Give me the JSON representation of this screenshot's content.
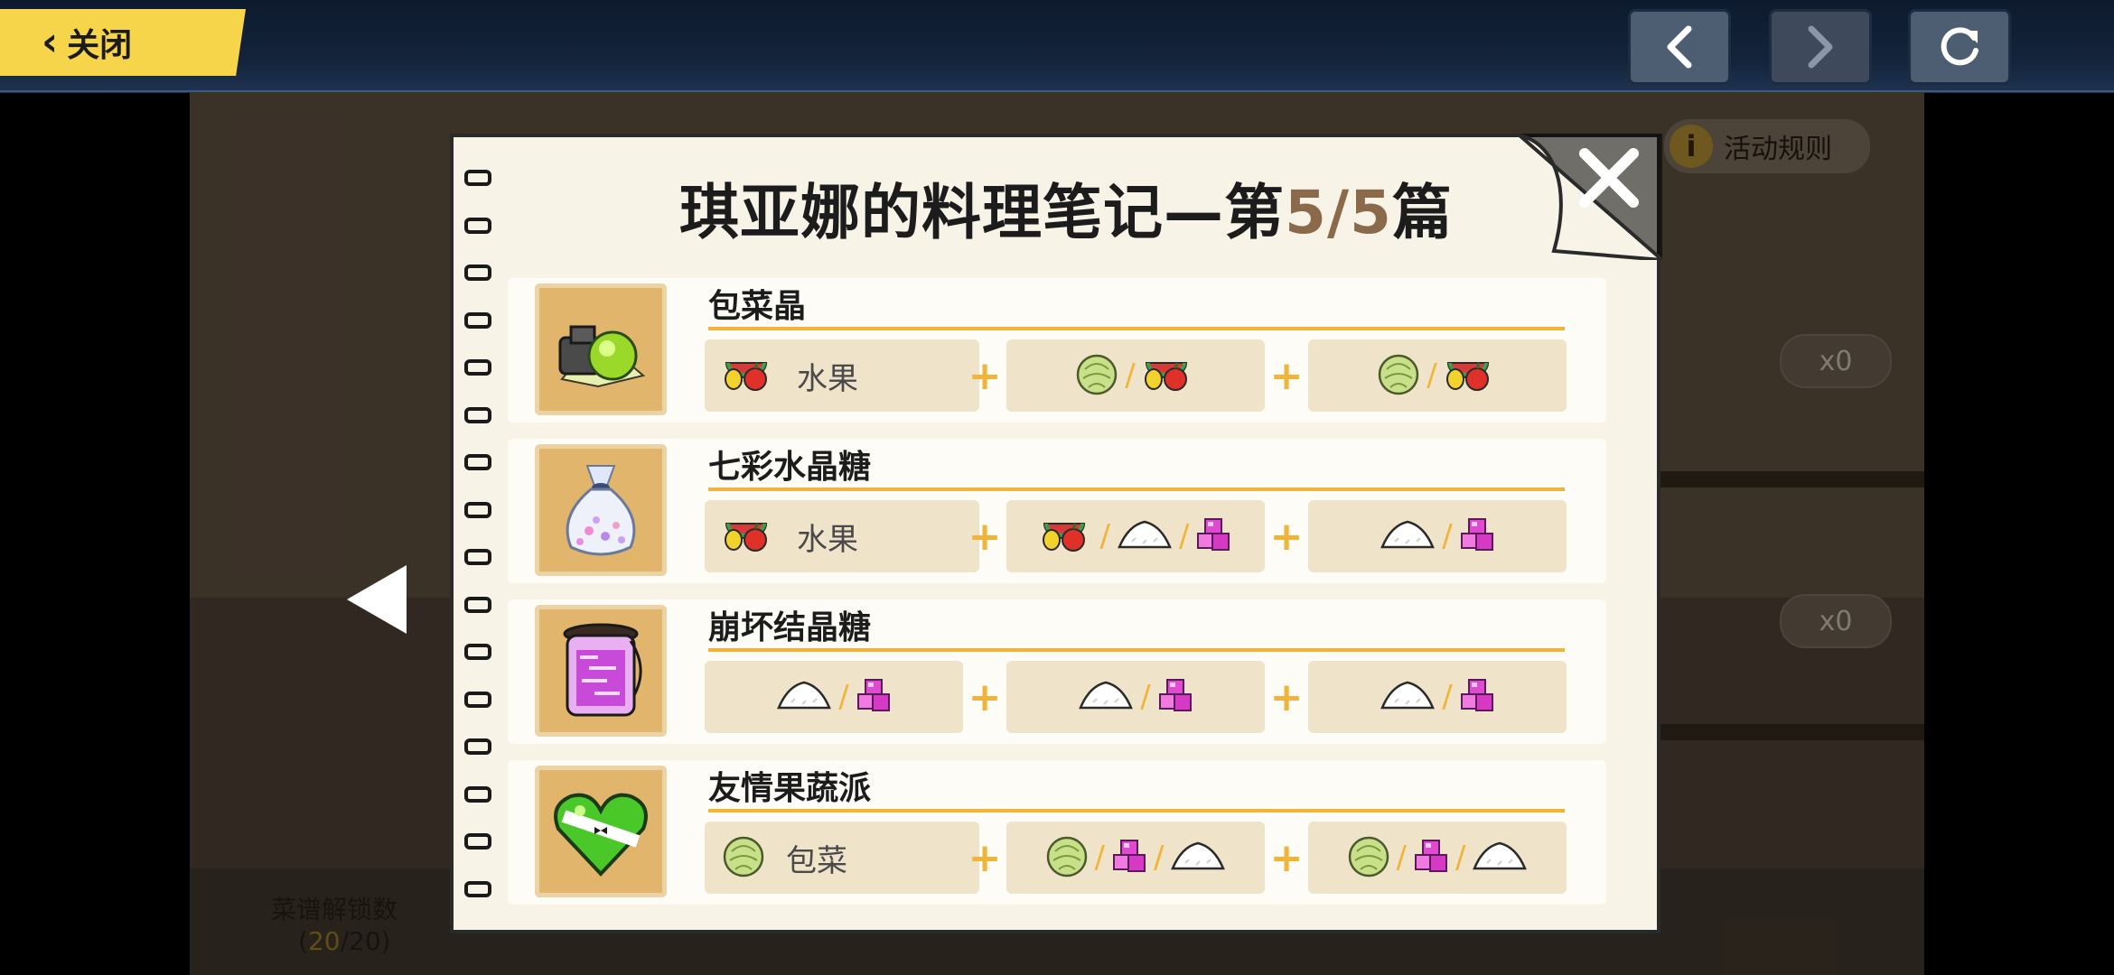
{
  "top_bar": {
    "close_label": "关闭",
    "prev_icon": "chevron-left-icon",
    "next_icon": "chevron-right-icon",
    "refresh_icon": "refresh-icon"
  },
  "background": {
    "rules_label": "活动规则",
    "counts": [
      "x0",
      "x0"
    ],
    "unlock_label": "菜谱解锁数",
    "unlock_current": "20",
    "unlock_total": "/20"
  },
  "notebook": {
    "title_prefix": "琪亚娜的料理笔记—第",
    "title_page": "5/5",
    "title_suffix": "篇",
    "recipes": [
      {
        "name": "包菜晶",
        "dish_icon": "cabbage-crystal-dish-icon",
        "slots": [
          {
            "icons": [
              "fruit-icon"
            ],
            "label": "水果"
          },
          {
            "icons": [
              "cabbage-icon",
              "fruit-icon"
            ],
            "label": ""
          },
          {
            "icons": [
              "cabbage-icon",
              "fruit-icon"
            ],
            "label": ""
          }
        ]
      },
      {
        "name": "七彩水晶糖",
        "dish_icon": "crystal-candy-bag-icon",
        "slots": [
          {
            "icons": [
              "fruit-icon"
            ],
            "label": "水果"
          },
          {
            "icons": [
              "fruit-icon",
              "sugar-icon",
              "cube-crystal-icon"
            ],
            "label": ""
          },
          {
            "icons": [
              "sugar-icon",
              "cube-crystal-icon"
            ],
            "label": ""
          }
        ]
      },
      {
        "name": "崩坏结晶糖",
        "dish_icon": "crystal-candy-jar-icon",
        "slots": [
          {
            "icons": [
              "sugar-icon",
              "cube-crystal-icon"
            ],
            "label": ""
          },
          {
            "icons": [
              "sugar-icon",
              "cube-crystal-icon"
            ],
            "label": ""
          },
          {
            "icons": [
              "sugar-icon",
              "cube-crystal-icon"
            ],
            "label": ""
          }
        ]
      },
      {
        "name": "友情果蔬派",
        "dish_icon": "heart-pie-icon",
        "slots": [
          {
            "icons": [
              "cabbage-icon"
            ],
            "label": "包菜"
          },
          {
            "icons": [
              "cabbage-icon",
              "cube-crystal-icon",
              "sugar-icon"
            ],
            "label": ""
          },
          {
            "icons": [
              "cabbage-icon",
              "cube-crystal-icon",
              "sugar-icon"
            ],
            "label": ""
          }
        ]
      }
    ]
  },
  "colors": {
    "accent_yellow": "#f6d54a",
    "line_orange": "#f0b43a",
    "paper": "#f7f3e7",
    "slot_bg": "#efe3c9",
    "dish_frame": "#e2b56c",
    "page_number": "#8a6a4a"
  }
}
